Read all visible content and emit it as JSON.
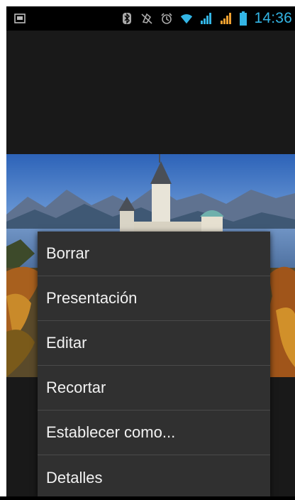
{
  "status_bar": {
    "left_icon": "screenshot-notification-icon",
    "icons": [
      "bluetooth-icon",
      "vibrate-icon",
      "alarm-icon",
      "wifi-icon",
      "signal-icon",
      "signal-icon",
      "battery-icon"
    ],
    "time": "14:36",
    "accent_color": "#33b5e5"
  },
  "photo": {
    "description_icon": "castle-photo"
  },
  "context_menu": {
    "items": [
      {
        "label": "Borrar"
      },
      {
        "label": "Presentación"
      },
      {
        "label": "Editar"
      },
      {
        "label": "Recortar"
      },
      {
        "label": "Establecer como..."
      },
      {
        "label": "Detalles"
      }
    ]
  }
}
